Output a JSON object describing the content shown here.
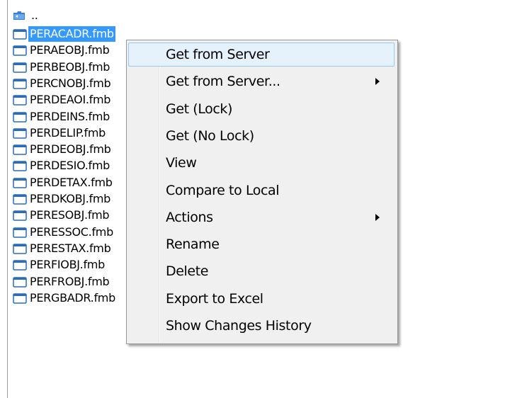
{
  "parent_label": "..",
  "files": [
    {
      "name": "PERACADR.fmb",
      "selected": true
    },
    {
      "name": "PERAEOBJ.fmb"
    },
    {
      "name": "PERBEOBJ.fmb"
    },
    {
      "name": "PERCNOBJ.fmb"
    },
    {
      "name": "PERDEAOI.fmb"
    },
    {
      "name": "PERDEINS.fmb"
    },
    {
      "name": "PERDELIP.fmb"
    },
    {
      "name": "PERDEOBJ.fmb"
    },
    {
      "name": "PERDESIO.fmb"
    },
    {
      "name": "PERDETAX.fmb"
    },
    {
      "name": "PERDKOBJ.fmb"
    },
    {
      "name": "PERESOBJ.fmb"
    },
    {
      "name": "PERESSOC.fmb"
    },
    {
      "name": "PERESTAX.fmb"
    },
    {
      "name": "PERFIOBJ.fmb"
    },
    {
      "name": "PERFROBJ.fmb"
    },
    {
      "name": "PERGBADR.fmb"
    }
  ],
  "context_menu": {
    "items": [
      {
        "label": "Get from Server",
        "hover": true
      },
      {
        "label": "Get from Server...",
        "submenu": true
      },
      {
        "label": "Get (Lock)"
      },
      {
        "label": "Get (No Lock)"
      },
      {
        "label": "View"
      },
      {
        "label": "Compare to Local"
      },
      {
        "label": "Actions",
        "submenu": true
      },
      {
        "label": "Rename"
      },
      {
        "label": "Delete"
      },
      {
        "label": "Export to Excel"
      },
      {
        "label": "Show Changes History"
      }
    ]
  },
  "colors": {
    "selection": "#3399ff",
    "menu_bg": "#f0f0f0",
    "menu_hover": "#e5f1fb"
  }
}
